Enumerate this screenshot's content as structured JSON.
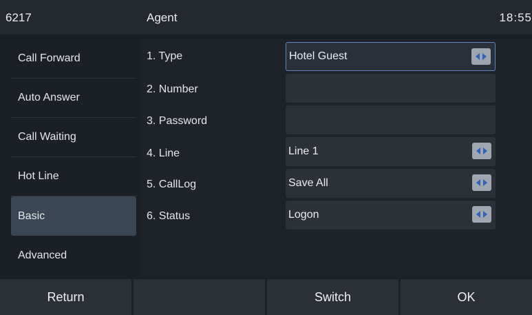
{
  "status_bar": {
    "extension": "6217",
    "title": "Agent",
    "time": "18:55"
  },
  "menu": {
    "items": [
      {
        "label": "Call Forward",
        "selected": false
      },
      {
        "label": "Auto Answer",
        "selected": false
      },
      {
        "label": "Call Waiting",
        "selected": false
      },
      {
        "label": "Hot Line",
        "selected": false
      },
      {
        "label": "Basic",
        "selected": true
      },
      {
        "label": "Advanced",
        "selected": false
      }
    ]
  },
  "form": {
    "fields": [
      {
        "label": "1. Type",
        "value": "Hotel Guest",
        "control": "selector",
        "focused": true
      },
      {
        "label": "2. Number",
        "value": "",
        "control": "text"
      },
      {
        "label": "3. Password",
        "value": "",
        "control": "password"
      },
      {
        "label": "4. Line",
        "value": "Line 1",
        "control": "selector"
      },
      {
        "label": "5. CallLog",
        "value": "Save All",
        "control": "selector"
      },
      {
        "label": "6. Status",
        "value": "Logon",
        "control": "selector"
      }
    ]
  },
  "softkeys": {
    "return": "Return",
    "empty": "",
    "switch": "Switch",
    "ok": "OK"
  },
  "icons": {
    "selector_arrows": "left-right-arrows-icon"
  },
  "colors": {
    "background": "#1b1f26",
    "selected_menu": "#3a4555",
    "focus_border": "#5d86c8",
    "arrow_icon": "#2f62b8"
  }
}
